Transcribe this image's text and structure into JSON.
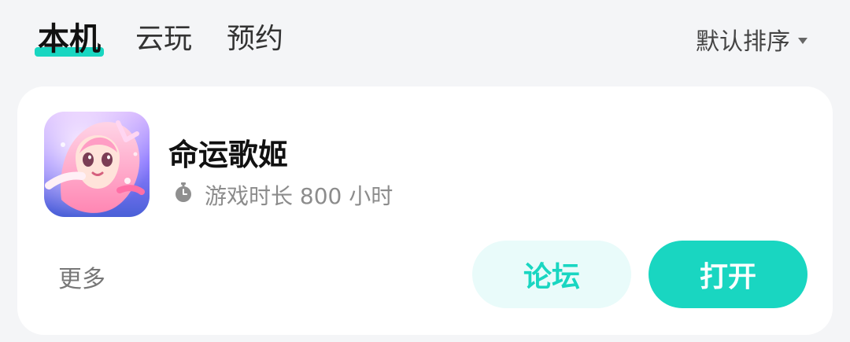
{
  "tabs": [
    {
      "label": "本机"
    },
    {
      "label": "云玩"
    },
    {
      "label": "预约"
    }
  ],
  "sort": {
    "label": "默认排序"
  },
  "game": {
    "title": "命运歌姬",
    "playtime": "游戏时长 800 小时"
  },
  "actions": {
    "more_label": "更多",
    "forum_label": "论坛",
    "open_label": "打开"
  },
  "icons": {
    "sort": "caret-down-icon",
    "timer": "stopwatch-icon",
    "app": "anime-girl-app-icon"
  },
  "colors": {
    "accent": "#19d6c1",
    "accent_light": "#e9fbfa",
    "background": "#f4f5f7",
    "card": "#ffffff"
  }
}
